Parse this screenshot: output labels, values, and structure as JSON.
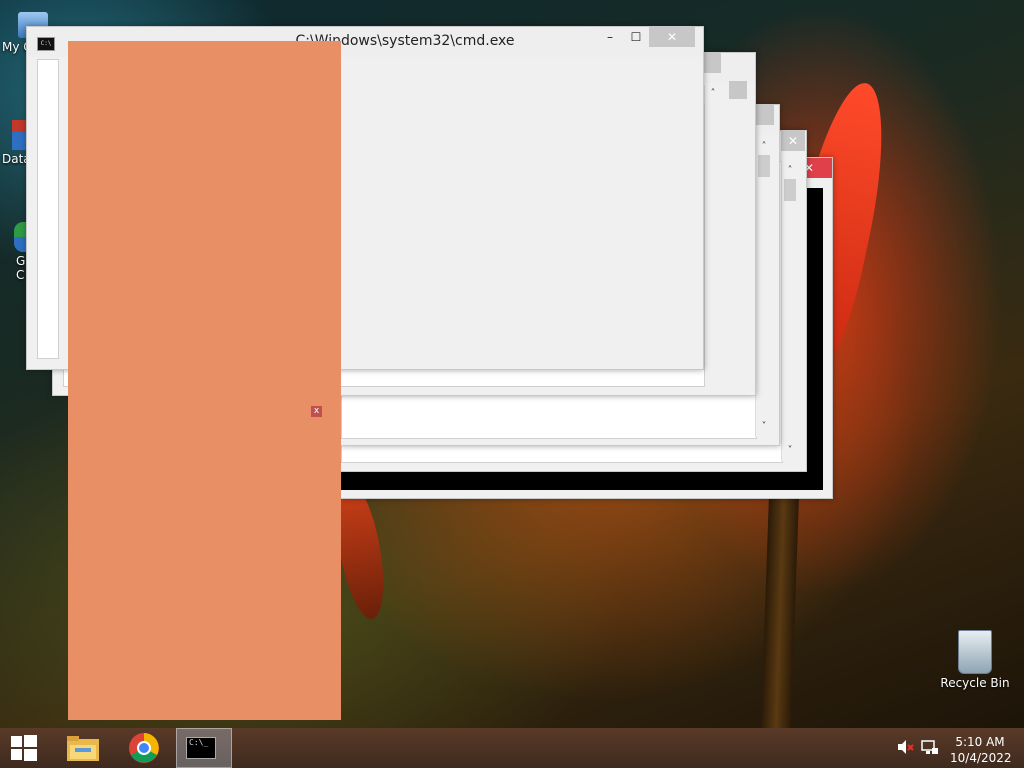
{
  "desktop": {
    "icons": [
      {
        "label": "My C"
      },
      {
        "label": "Data"
      },
      {
        "label": "G\nC"
      },
      {
        "label": "Recycle Bin"
      }
    ]
  },
  "windows": {
    "main": {
      "title": "C:\\Windows\\system32\\cmd.exe"
    },
    "min_glyph": "–",
    "max_glyph": "☐",
    "close_glyph": "✕",
    "up_arrow": "˄",
    "down_arrow": "˅"
  },
  "overlay": {
    "close_glyph": "x"
  },
  "taskbar": {
    "items": [
      {
        "name": "start",
        "icon": "windows-logo-icon"
      },
      {
        "name": "file-explorer",
        "icon": "folder-icon"
      },
      {
        "name": "chrome",
        "icon": "chrome-icon"
      },
      {
        "name": "cmd",
        "icon": "cmd-icon",
        "text": "C:\\_"
      }
    ]
  },
  "tray": {
    "time": "5:10 AM",
    "date": "10/4/2022"
  },
  "colors": {
    "overlay": "#e98f65",
    "taskbar": "#4a3222"
  }
}
